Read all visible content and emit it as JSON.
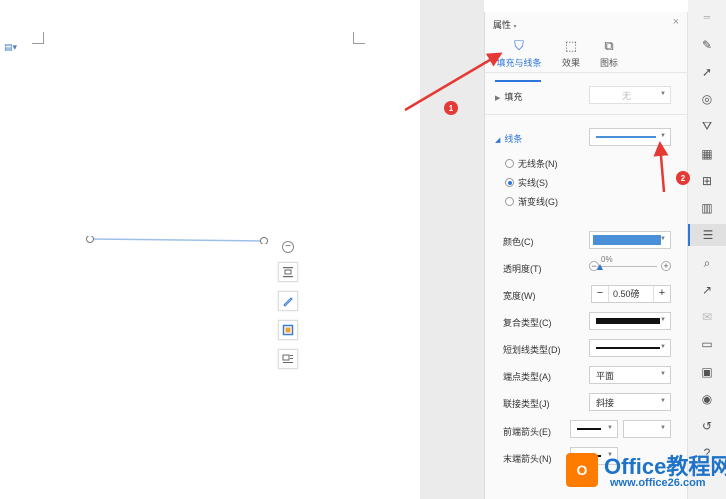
{
  "panel": {
    "title": "属性",
    "title_caret": "▾",
    "close": "×",
    "tabs": [
      {
        "label": "填充与线条",
        "icon": "fill-bucket-icon",
        "glyph": "⛉"
      },
      {
        "label": "效果",
        "icon": "effects-icon",
        "glyph": "⬚"
      },
      {
        "label": "图标",
        "icon": "shape-icon",
        "glyph": "⧉"
      }
    ],
    "fill": {
      "label": "填充",
      "value": "无"
    },
    "line": {
      "label": "线条",
      "options": [
        {
          "label": "无线条(N)",
          "selected": false
        },
        {
          "label": "实线(S)",
          "selected": true
        },
        {
          "label": "渐变线(G)",
          "selected": false
        }
      ],
      "color_label": "颜色(C)",
      "color_value": "#4a90d9",
      "transparency_label": "透明度(T)",
      "transparency_value": "0%",
      "width_label": "宽度(W)",
      "width_value": "0.50磅",
      "minus": "−",
      "plus": "+",
      "compound_label": "复合类型(C)",
      "dash_label": "短划线类型(D)",
      "cap_label": "端点类型(A)",
      "cap_value": "平面",
      "join_label": "联接类型(J)",
      "join_value": "斜接",
      "begin_arrow_label": "前端箭头(E)",
      "end_arrow_label": "末端箭头(N)"
    }
  },
  "annotations": {
    "badge1": "1",
    "badge2": "2",
    "arrow_color": "#e53935"
  },
  "watermark": {
    "logo": "O",
    "line1": "Office教程网",
    "line2": "www.office26.com"
  },
  "colors": {
    "accent": "#2e75d9",
    "line_shape": "#9ec0e8"
  }
}
